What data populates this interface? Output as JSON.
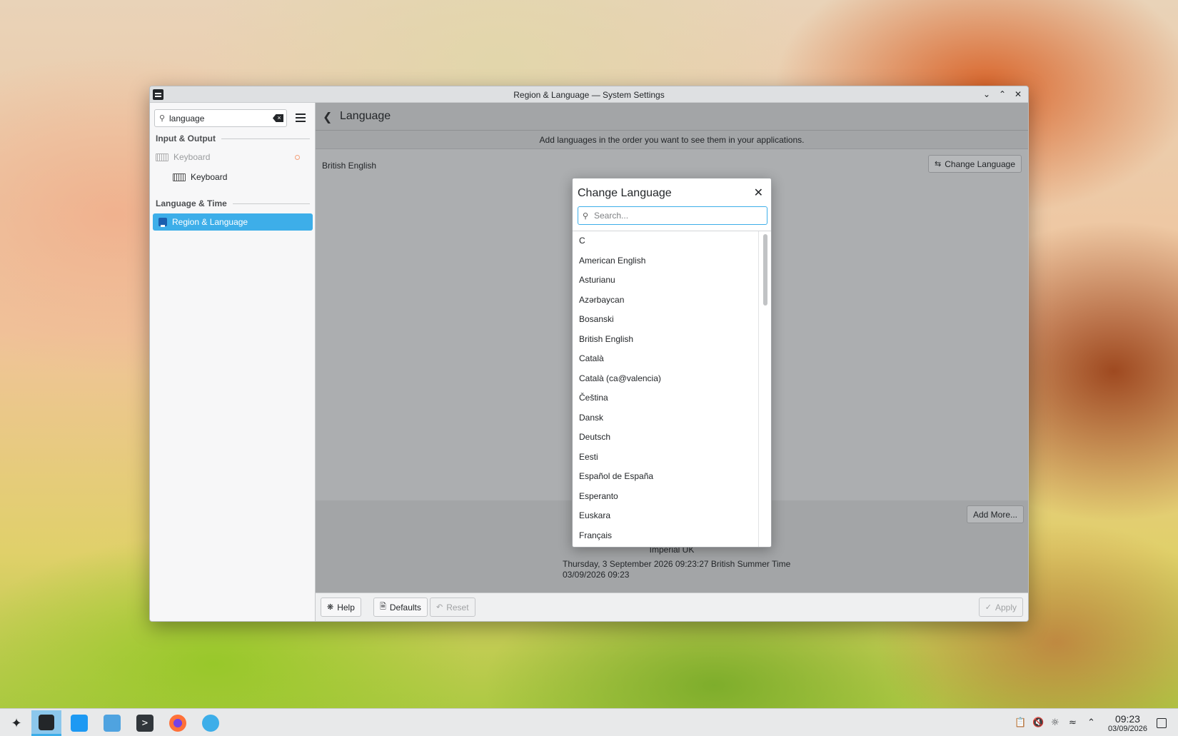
{
  "window": {
    "title": "Region & Language — System Settings"
  },
  "sidebar": {
    "search_value": "language",
    "sections": [
      {
        "label": "Input & Output"
      },
      {
        "label": "Language & Time"
      }
    ],
    "items": [
      {
        "label": "Keyboard"
      },
      {
        "label": "Keyboard"
      },
      {
        "label": "Region & Language"
      }
    ]
  },
  "main": {
    "title": "Language",
    "info": "Add languages in the order you want to see them in your applications.",
    "current_language": "British English",
    "change_language_button": "Change Language",
    "add_more_button": "Add More...",
    "summary": {
      "measurement": "Imperial UK",
      "long_date": "Thursday, 3 September 2026 09:23:27 British Summer Time",
      "short_date": "03/09/2026 09:23"
    }
  },
  "footer": {
    "help": "Help",
    "defaults": "Defaults",
    "reset": "Reset",
    "apply": "Apply"
  },
  "dialog": {
    "title": "Change Language",
    "search_placeholder": "Search...",
    "languages": [
      "C",
      "American English",
      "Asturianu",
      "Azərbaycan",
      "Bosanski",
      "British English",
      "Català",
      "Català (ca@valencia)",
      "Čeština",
      "Dansk",
      "Deutsch",
      "Eesti",
      "Español de España",
      "Esperanto",
      "Euskara",
      "Français"
    ]
  },
  "taskbar": {
    "time": "09:23",
    "date": "03/09/2026"
  },
  "colors": {
    "accent": "#3daee9",
    "selected_bg": "#3daee9"
  }
}
